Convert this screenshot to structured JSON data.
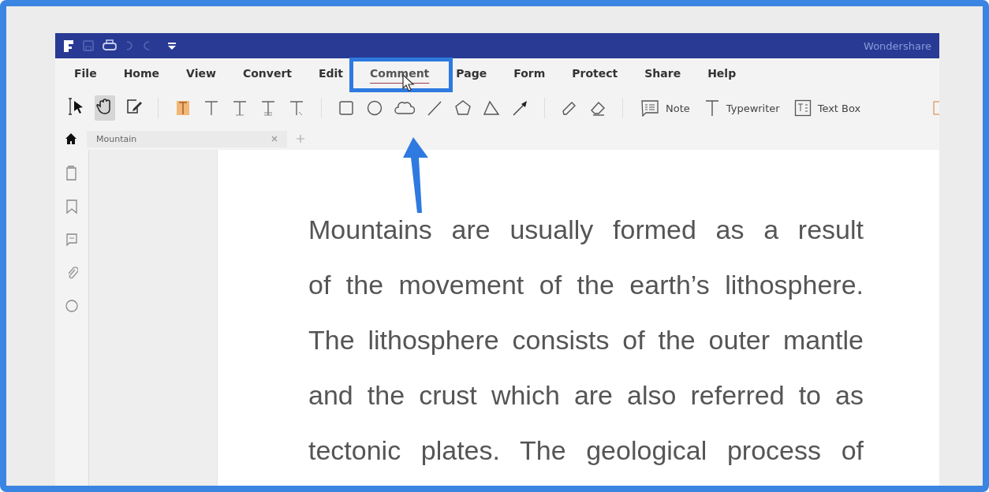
{
  "title_bar": {
    "brand": "Wondershare"
  },
  "menu": [
    {
      "label": "File",
      "selected": false
    },
    {
      "label": "Home",
      "selected": false
    },
    {
      "label": "View",
      "selected": false
    },
    {
      "label": "Convert",
      "selected": false
    },
    {
      "label": "Edit",
      "selected": false
    },
    {
      "label": "Comment",
      "selected": true
    },
    {
      "label": "Page",
      "selected": false
    },
    {
      "label": "Form",
      "selected": false
    },
    {
      "label": "Protect",
      "selected": false
    },
    {
      "label": "Share",
      "selected": false
    },
    {
      "label": "Help",
      "selected": false
    }
  ],
  "mode_tools": [
    {
      "kind": "select",
      "selected": false
    },
    {
      "kind": "hand",
      "selected": true
    },
    {
      "kind": "edit",
      "selected": false
    }
  ],
  "labeled_tools": [
    {
      "kind": "note",
      "label": "Note"
    },
    {
      "kind": "typewriter",
      "label": "Typewriter"
    },
    {
      "kind": "textbox",
      "label": "Text Box"
    }
  ],
  "tab": {
    "label": "Mountain"
  },
  "document": {
    "lines": [
      "Mountains are usually formed as a result",
      "of the movement of the earth’s lithosphere.",
      "The lithosphere consists of the outer mantle",
      "and the crust which are also referred to as",
      "tectonic plates. The geological process of"
    ]
  }
}
